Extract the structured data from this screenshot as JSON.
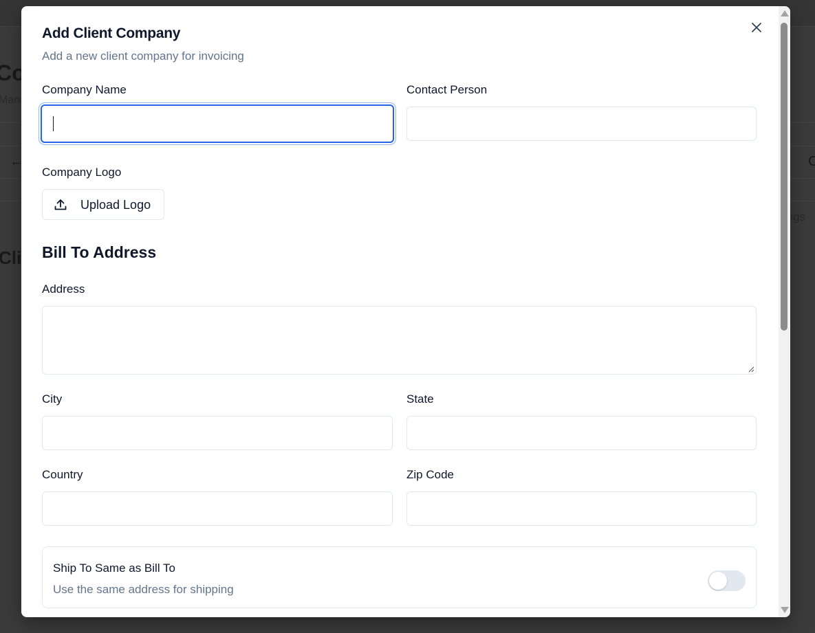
{
  "background": {
    "title_fragment": "Co",
    "subtitle_fragment": "Mana",
    "section_fragment": "Cli",
    "settings_fragment": "ings",
    "right_fragment": "C"
  },
  "modal": {
    "title": "Add Client Company",
    "description": "Add a new client company for invoicing",
    "close_icon": "close-icon"
  },
  "fields": {
    "company_name": {
      "label": "Company Name",
      "value": "",
      "placeholder": ""
    },
    "contact_person": {
      "label": "Contact Person",
      "value": "",
      "placeholder": ""
    },
    "company_logo": {
      "label": "Company Logo",
      "button_label": "Upload Logo",
      "icon": "upload-icon"
    },
    "address": {
      "label": "Address",
      "value": ""
    },
    "city": {
      "label": "City",
      "value": ""
    },
    "state": {
      "label": "State",
      "value": ""
    },
    "country": {
      "label": "Country",
      "value": ""
    },
    "zip_code": {
      "label": "Zip Code",
      "value": ""
    }
  },
  "bill_to_heading": "Bill To Address",
  "ship_same": {
    "title": "Ship To Same as Bill To",
    "description": "Use the same address for shipping",
    "enabled": false
  },
  "colors": {
    "accent": "#2563eb",
    "border": "#e2e8f0",
    "muted_text": "#64748b",
    "text": "#0f172a",
    "overlay": "#3b3b3b"
  }
}
